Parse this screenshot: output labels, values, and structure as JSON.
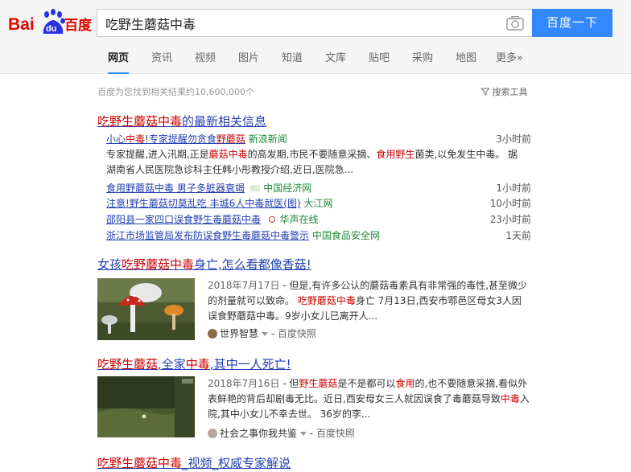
{
  "header": {
    "logo_left": "Bai",
    "logo_paw": "du",
    "logo_right": "百度",
    "query": "吃野生蘑菇中毒",
    "search_button": "百度一下",
    "camera_icon": "camera-icon"
  },
  "tabs": [
    "网页",
    "资讯",
    "视频",
    "图片",
    "知道",
    "文库",
    "贴吧",
    "采购",
    "地图",
    "更多»"
  ],
  "stats": "百度为您找到相关结果约10,600,000个",
  "tools": "搜索工具",
  "news_block": {
    "title_hl": "吃野生蘑菇中毒",
    "title_rest": "的最新相关信息",
    "first": {
      "t1": "小心",
      "t2": "中毒",
      "t3": "!专家提醒勿贪食",
      "t4": "野蘑菇",
      "source": "新浪新闻",
      "time": "3小时前",
      "abs1": "专家提醒,进入汛期,正是",
      "abs2": "蘑菇中毒",
      "abs3": "的高发期,市民不要随意采摘、",
      "abs4": "食用野生",
      "abs5": "菌类,以免发生中毒。 据湖南省人民医院急诊科主任韩小彤教授介绍,近日,医院急..."
    },
    "items": [
      {
        "title": "食用野蘑菇中毒 男子多脏器衰竭",
        "source": "中国经济网",
        "time": "1小时前"
      },
      {
        "title": "注意!野生蘑菇切莫乱吃 丰城6人中毒就医(图)",
        "source": "大江网",
        "time": "10小时前"
      },
      {
        "title": "邵阳县一家四口误食野生毒蘑菇中毒",
        "source": "华声在线",
        "time": "23小时前"
      },
      {
        "title": "浙江市场监管局发布防误食野生毒蘑菇中毒警示",
        "source": "中国食品安全网",
        "time": "1天前"
      }
    ]
  },
  "result2": {
    "title_pre": "女孩",
    "title_hl": "吃野蘑菇中毒",
    "title_post": "身亡,怎么看都像香菇!",
    "date": "2018年7月17日",
    "abs_a": " - 但是,有许多公认的蘑菇毒素具有非常强的毒性,甚至微少的剂量就可以致命。 ",
    "abs_hl": "吃野蘑菇中毒",
    "abs_b": "身亡 7月13日,西安市鄠邑区母女3人因误食野蘑菇中毒。9岁小女儿已离开人...",
    "source": "世界智慧",
    "cache": "百度快照"
  },
  "result3": {
    "title_hl1": "吃野生蘑菇",
    "title_mid": ",全家",
    "title_hl2": "中毒",
    "title_post": ",其中一人死亡!",
    "date": "2018年7月16日",
    "abs_a": " - 但",
    "abs_hl1": "野生蘑菇",
    "abs_b": "是不是都可以",
    "abs_hl2": "食用",
    "abs_c": "的,也不要随意采摘,看似外表鲜艳的背后却剧毒无比。近日,西安母女三人就因误食了毒蘑菇导致",
    "abs_hl3": "中毒",
    "abs_d": "入院,其中小女儿不幸去世。 36岁的李...",
    "source": "社会之事你我共鉴",
    "cache": "百度快照"
  },
  "result4": {
    "title_hl": "吃野生蘑菇中毒",
    "title_post": "_视频_权威专家解说"
  }
}
